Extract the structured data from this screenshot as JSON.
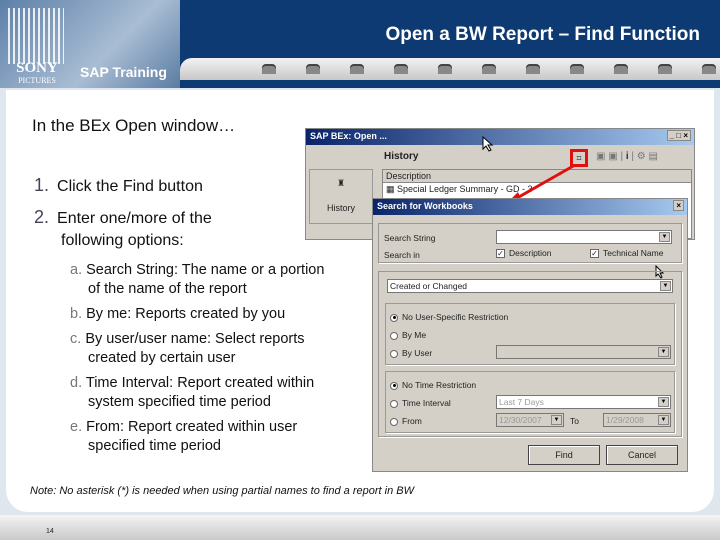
{
  "header": {
    "title": "Open a BW Report – Find Function",
    "brand_top": "SONY",
    "brand_bottom": "PICTURES",
    "product": "SAP Training"
  },
  "slide": {
    "intro": "In the BEx Open window…",
    "steps": [
      {
        "num": "1.",
        "text": "Click the Find button"
      },
      {
        "num": "2.",
        "text": "Enter one/more of the following options:"
      }
    ],
    "options": [
      {
        "letter": "a.",
        "text": "Search String: The name or a portion of the name of the report"
      },
      {
        "letter": "b.",
        "text": "By me: Reports created by you"
      },
      {
        "letter": "c.",
        "text": "By user/user name: Select reports created by certain user"
      },
      {
        "letter": "d.",
        "text": "Time Interval: Report created within system specified time period"
      },
      {
        "letter": "e.",
        "text": "From: Report created within user specified time period"
      }
    ],
    "note": "Note:  No asterisk (*) is needed when using partial names to find a report in BW",
    "page_number": "14"
  },
  "open_window": {
    "title": "SAP BEx: Open ...",
    "section": "History",
    "column": "Description",
    "row": "Special Ledger Summary - GD - 3",
    "nav": "History"
  },
  "search_dialog": {
    "title": "Search for Workbooks",
    "search_string_label": "Search String",
    "search_string_value": "",
    "search_in_label": "Search in",
    "description_label": "Description",
    "description_checked": true,
    "technical_label": "Technical Name",
    "technical_checked": true,
    "date_type": "Created or Changed",
    "user_options": [
      "No User-Specific Restriction",
      "By Me",
      "By User"
    ],
    "user_selected": 0,
    "time_options": [
      "No Time Restriction",
      "Time Interval",
      "From"
    ],
    "time_selected": 0,
    "interval": "Last 7 Days",
    "from_date": "12/30/2007",
    "to_label": "To",
    "to_date": "1/29/2008",
    "find_label": "Find",
    "cancel_label": "Cancel"
  },
  "colors": {
    "header": "#0d3a72",
    "highlight": "#e01010"
  }
}
